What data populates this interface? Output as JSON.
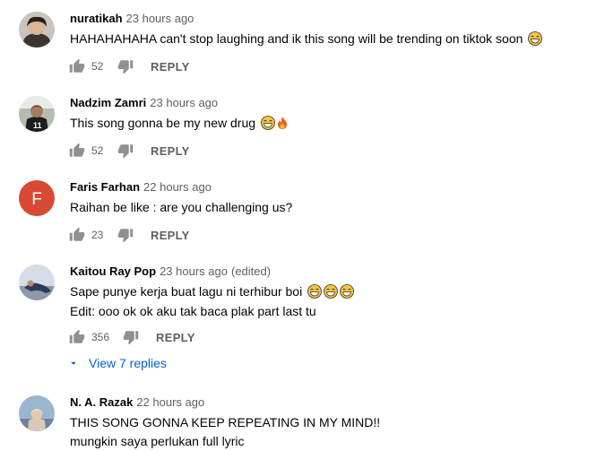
{
  "comments": [
    {
      "author": "nuratikah",
      "time": "23 hours ago",
      "edited": "",
      "lines": [
        "HAHAHAHAHA can't stop laughing and ik this song will be trending on tiktok soon"
      ],
      "emojis": [
        "grinning-sweat-emoji"
      ],
      "likes": "52",
      "reply_label": "REPLY"
    },
    {
      "author": "Nadzim Zamri",
      "time": "23 hours ago",
      "edited": "",
      "lines": [
        "This song gonna be my new drug"
      ],
      "emojis": [
        "grinning-sweat-emoji",
        "fire-emoji"
      ],
      "likes": "52",
      "reply_label": "REPLY"
    },
    {
      "author": "Faris Farhan",
      "time": "22 hours ago",
      "edited": "",
      "avatar_letter": "F",
      "avatar_color": "#d84a33",
      "lines": [
        "Raihan be like : are you challenging us?"
      ],
      "likes": "23",
      "reply_label": "REPLY"
    },
    {
      "author": "Kaitou Ray Pop",
      "time": "23 hours ago",
      "edited": "(edited)",
      "lines": [
        "Sape punye kerja buat lagu ni terhibur boi",
        "Edit: ooo ok ok aku tak baca plak part last tu"
      ],
      "emojis": [
        "grinning-sweat-emoji",
        "grinning-sweat-emoji",
        "grinning-sweat-emoji"
      ],
      "likes": "356",
      "reply_label": "REPLY",
      "view_replies": "View 7 replies"
    },
    {
      "author": "N. A. Razak",
      "time": "22 hours ago",
      "edited": "",
      "lines": [
        "THIS SONG GONNA KEEP REPEATING IN MY MIND!!",
        "mungkin saya perlukan full lyric"
      ]
    }
  ],
  "colors": {
    "text": "#030303",
    "secondary": "#606060",
    "link": "#065fd4"
  }
}
